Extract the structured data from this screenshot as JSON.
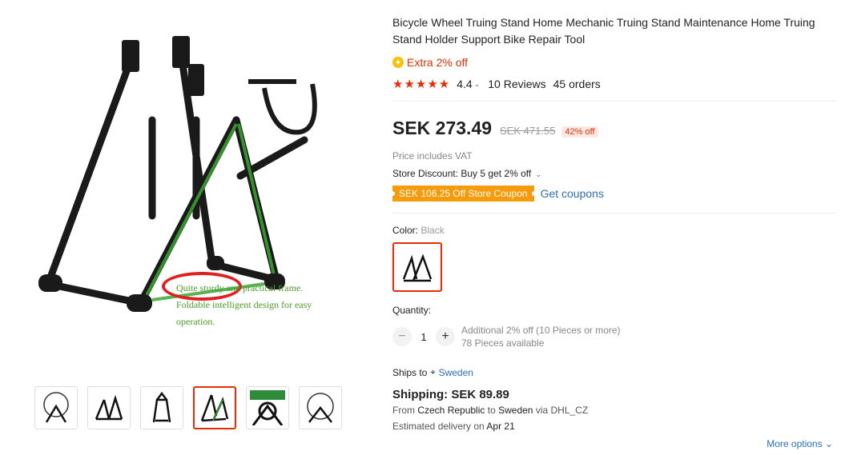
{
  "gallery": {
    "caption_line1": "Quite sturdy and practical frame.",
    "caption_line2": "Foldable intelligent design for easy",
    "caption_line3": "operation.",
    "thumbnails": [
      "wheel-on-stand",
      "stand-folded",
      "stand-front",
      "stand-frame",
      "stand-green-detail",
      "wheel-on-stand-2"
    ]
  },
  "product": {
    "title": "Bicycle Wheel Truing Stand Home Mechanic Truing Stand Maintenance Home Truing Stand Holder Support Bike Repair Tool",
    "extra_off": "Extra 2% off",
    "rating": "4.4",
    "reviews": "10 Reviews",
    "orders": "45 orders",
    "price": "SEK 273.49",
    "old_price": "SEK 471.55",
    "discount": "42% off",
    "vat": "Price includes VAT",
    "store_discount": "Store Discount: Buy 5 get 2% off",
    "coupon": "SEK 106.25 Off Store Coupon",
    "get_coupons": "Get coupons"
  },
  "color": {
    "label": "Color:",
    "value": "Black"
  },
  "quantity": {
    "label": "Quantity:",
    "value": "1",
    "note_line1": "Additional 2% off (10 Pieces or more)",
    "note_line2": "78 Pieces available"
  },
  "shipping": {
    "ships_to_label": "Ships to",
    "country": "Sweden",
    "cost": "Shipping: SEK 89.89",
    "from_prefix": "From",
    "from_country": "Czech Republic",
    "to_word": "to",
    "to_country": "Sweden",
    "via": "via DHL_CZ",
    "est_prefix": "Estimated delivery on",
    "est_date": "Apr 21",
    "more_options": "More options"
  },
  "colors": {
    "accent": "#e62e04",
    "link": "#2e6fb5",
    "coupon": "#f59b0c",
    "green": "#4a9d2a"
  }
}
